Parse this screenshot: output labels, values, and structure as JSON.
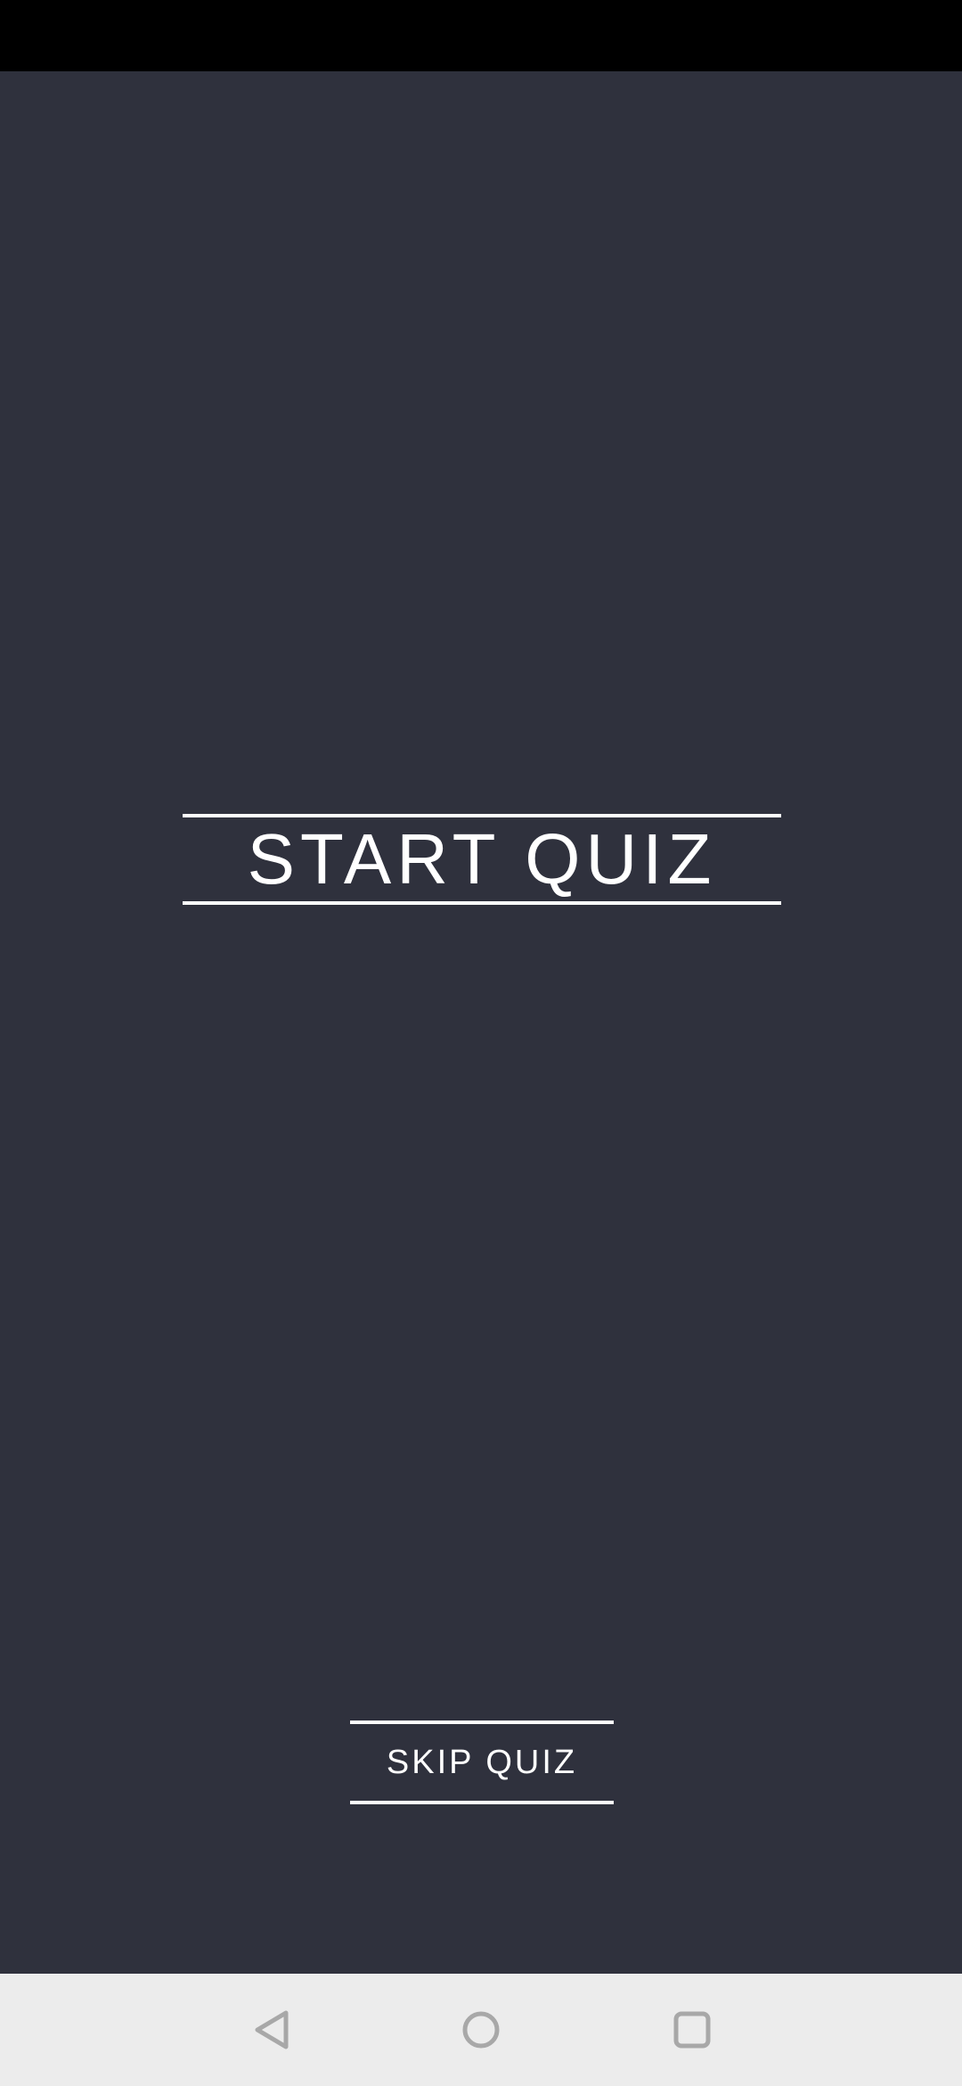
{
  "main": {
    "start_label": "START QUIZ",
    "skip_label": "SKIP QUIZ"
  },
  "navigation": {
    "back_icon": "back-triangle-icon",
    "home_icon": "home-circle-icon",
    "recents_icon": "recents-square-icon"
  },
  "colors": {
    "background": "#2f313d",
    "status_bar": "#000000",
    "text": "#ffffff",
    "nav_bar": "#ececec",
    "nav_icon": "#a8a8a8"
  }
}
